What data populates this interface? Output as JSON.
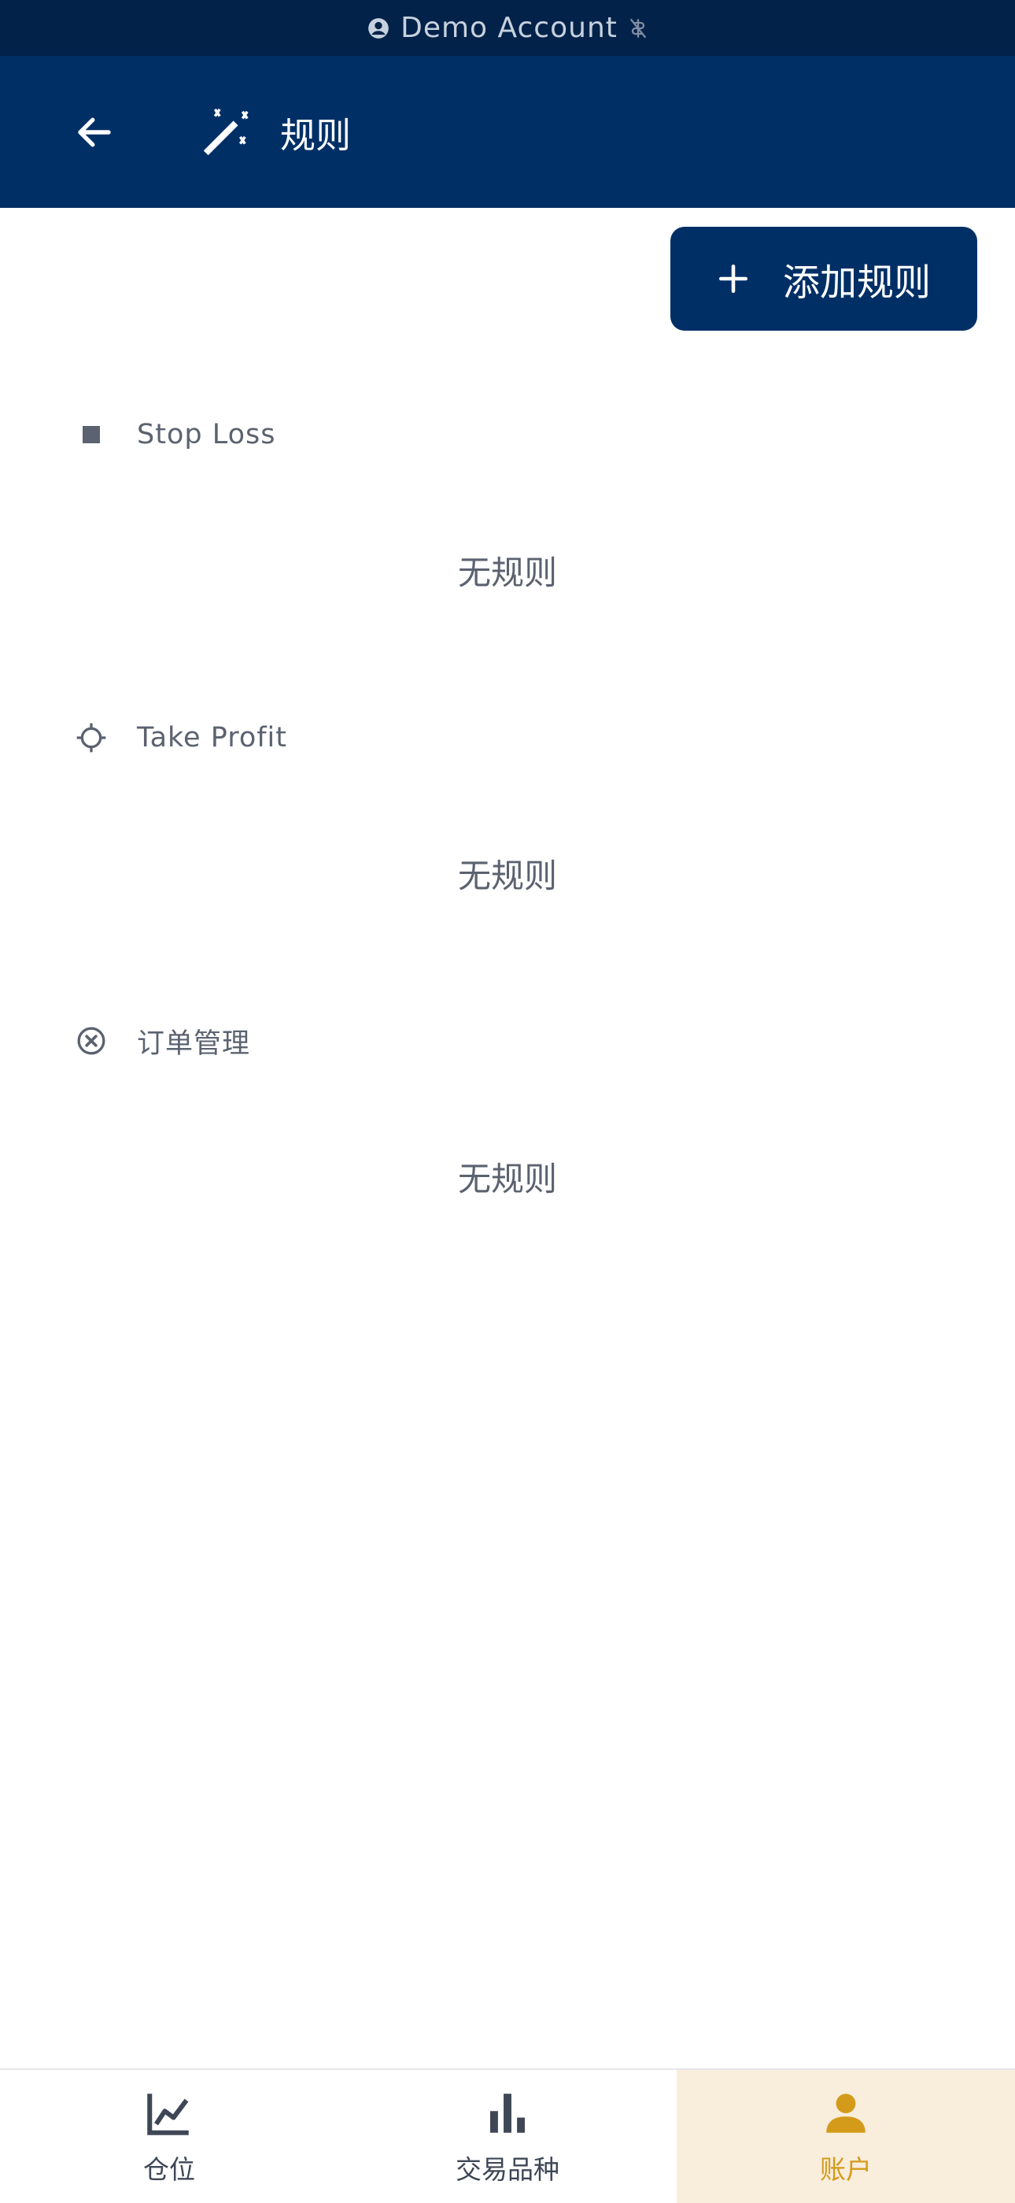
{
  "status_bar": {
    "account_label": "Demo Account"
  },
  "app_bar": {
    "title": "规则"
  },
  "actions": {
    "add_rule_label": "添加规则"
  },
  "sections": [
    {
      "title": "Stop Loss",
      "empty_label": "无规则",
      "icon": "stop-square-icon"
    },
    {
      "title": "Take Profit",
      "empty_label": "无规则",
      "icon": "crosshair-icon"
    },
    {
      "title": "订单管理",
      "empty_label": "无规则",
      "icon": "cancel-circle-icon"
    }
  ],
  "bottom_nav": {
    "items": [
      {
        "label": "仓位",
        "icon": "line-chart-icon",
        "active": false
      },
      {
        "label": "交易品种",
        "icon": "bar-chart-icon",
        "active": false
      },
      {
        "label": "账户",
        "icon": "person-icon",
        "active": true
      }
    ]
  },
  "colors": {
    "status_bar_bg": "#022249",
    "primary": "#002f66",
    "accent": "#d49b1b",
    "active_nav_bg": "#f9eddb",
    "muted_text": "#5b6270"
  }
}
